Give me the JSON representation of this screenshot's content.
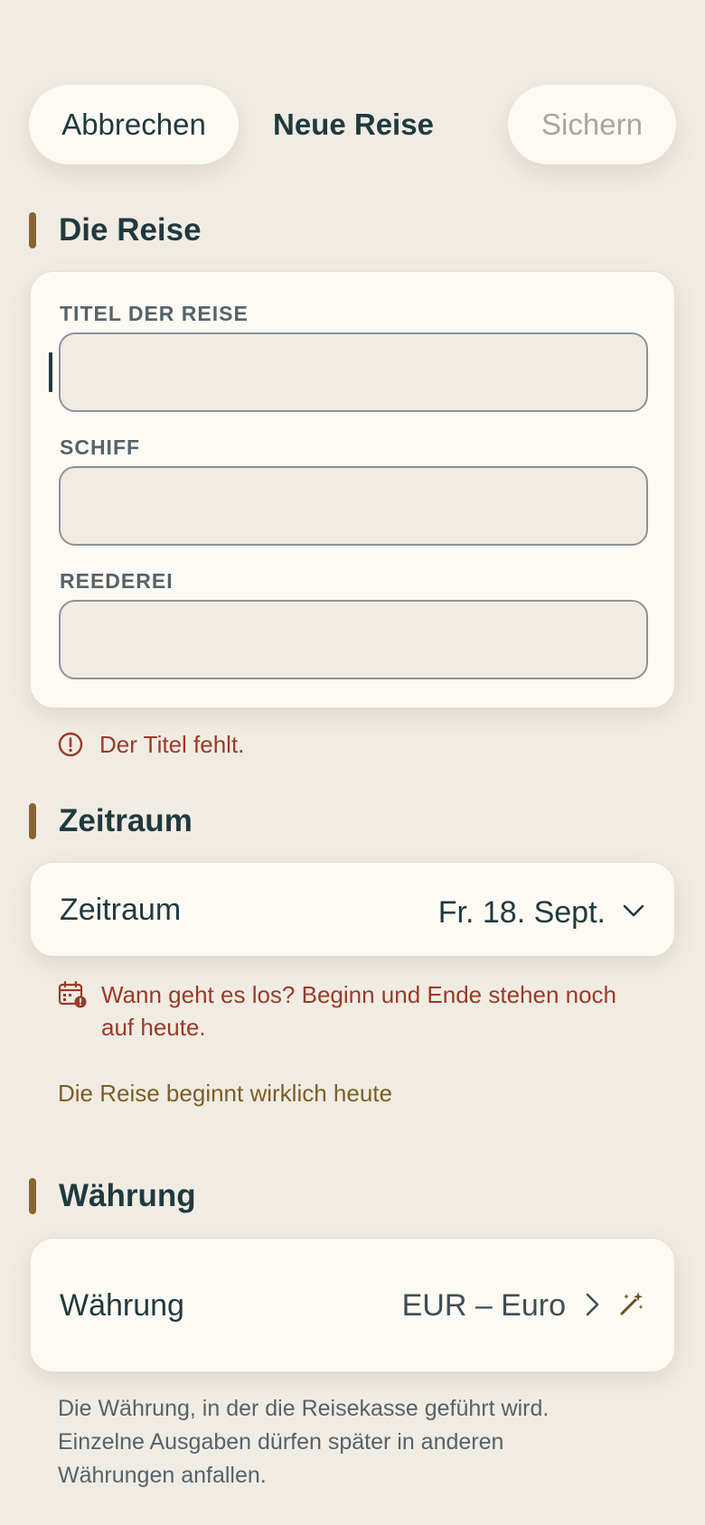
{
  "header": {
    "cancel_label": "Abbrechen",
    "title": "Neue Reise",
    "save_label": "Sichern"
  },
  "trip_section": {
    "title": "Die Reise",
    "fields": [
      {
        "label": "TITEL DER REISE",
        "value": "",
        "placeholder": ""
      },
      {
        "label": "SCHIFF",
        "value": "",
        "placeholder": ""
      },
      {
        "label": "REEDEREI",
        "value": "",
        "placeholder": ""
      }
    ],
    "error": "Der Titel fehlt."
  },
  "period_section": {
    "title": "Zeitraum",
    "row_label": "Zeitraum",
    "row_value": "Fr. 18. Sept.",
    "error_line1": "Wann geht es los? Beginn und Ende stehen noch",
    "error_line2": "auf heute.",
    "confirm_link": "Die Reise beginnt wirklich heute"
  },
  "currency_section": {
    "title": "Währung",
    "row_label": "Währung",
    "row_value": "EUR – Euro",
    "helper_line1": "Die Währung, in der die Reisekasse geführt wird.",
    "helper_line2": "Einzelne Ausgaben dürfen später in anderen",
    "helper_line3": "Währungen anfallen."
  },
  "colors": {
    "background": "#F1ECE3",
    "card": "#FDFAF3",
    "accent_bar": "#8A6430",
    "error": "#9A3A28",
    "link": "#7E5C24",
    "text": "#1F3A3F"
  },
  "icons": {
    "error": "exclamation-circle-icon",
    "calendar_error": "calendar-alert-icon",
    "chevron_down": "chevron-down-icon",
    "chevron_right": "chevron-right-icon",
    "auto": "magic-wand-icon"
  }
}
